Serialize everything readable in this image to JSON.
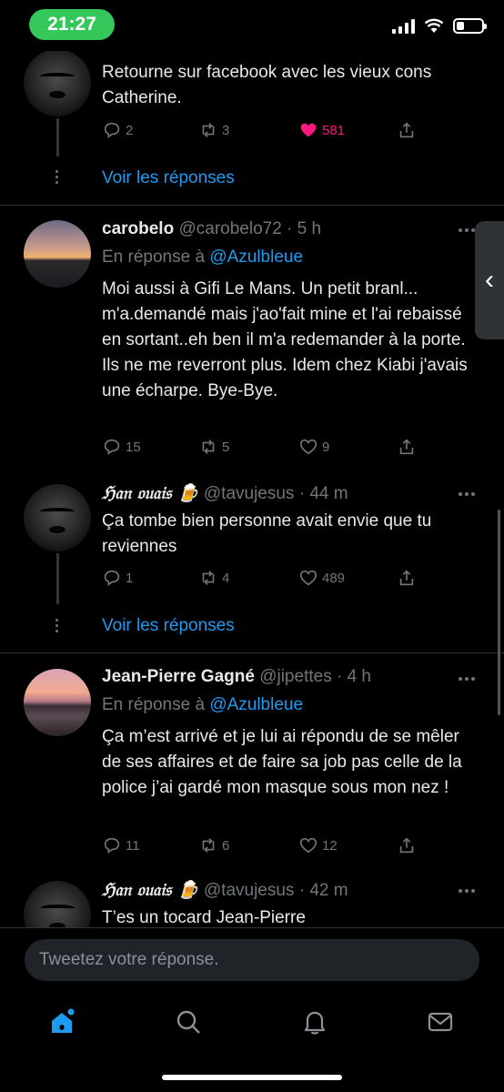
{
  "status_bar": {
    "time": "21:27"
  },
  "tweets": [
    {
      "text": "Retourne sur facebook avec les vieux cons Catherine.",
      "replies": "2",
      "retweets": "3",
      "likes": "581",
      "view_replies": "Voir les réponses"
    },
    {
      "name": "carobelo",
      "handle": "@carobelo72 · 5 h",
      "reply_prefix": "En réponse à",
      "reply_mention": "@Azulbleue",
      "text": "Moi aussi à Gifi Le Mans. Un petit branl... m'a.demandé mais j'ao'fait mine et l'ai rebaissé en sortant..eh ben il m'a redemander à la porte. Ils ne me reverront plus. Idem chez Kiabi j'avais une écharpe. Bye-Bye.",
      "replies": "15",
      "retweets": "5",
      "likes": "9"
    },
    {
      "name": "ℌ𝔞𝔫 𝔬𝔲𝔞𝔦𝔰 🍺",
      "handle": "@tavujesus · 44 m",
      "text": "Ça tombe bien personne avait envie que tu reviennes",
      "replies": "1",
      "retweets": "4",
      "likes": "489",
      "view_replies": "Voir les réponses"
    },
    {
      "name": "Jean-Pierre Gagné",
      "handle": "@jipettes · 4 h",
      "reply_prefix": "En réponse à",
      "reply_mention": "@Azulbleue",
      "text": "Ça m’est arrivé et je lui ai répondu de se mêler de ses affaires et de faire sa job pas celle de la police j’ai gardé mon masque sous mon nez !",
      "replies": "11",
      "retweets": "6",
      "likes": "12"
    },
    {
      "name": "ℌ𝔞𝔫 𝔬𝔲𝔞𝔦𝔰 🍺",
      "handle": "@tavujesus · 42 m",
      "text": "T’es un tocard Jean-Pierre"
    }
  ],
  "compose": {
    "placeholder": "Tweetez votre réponse."
  },
  "tab_bar": {
    "items": [
      "home-icon",
      "search-icon",
      "notifications-icon",
      "messages-icon"
    ]
  },
  "colors": {
    "accent": "#1d9bf0",
    "like": "#f91880",
    "time_pill": "#34c759"
  }
}
